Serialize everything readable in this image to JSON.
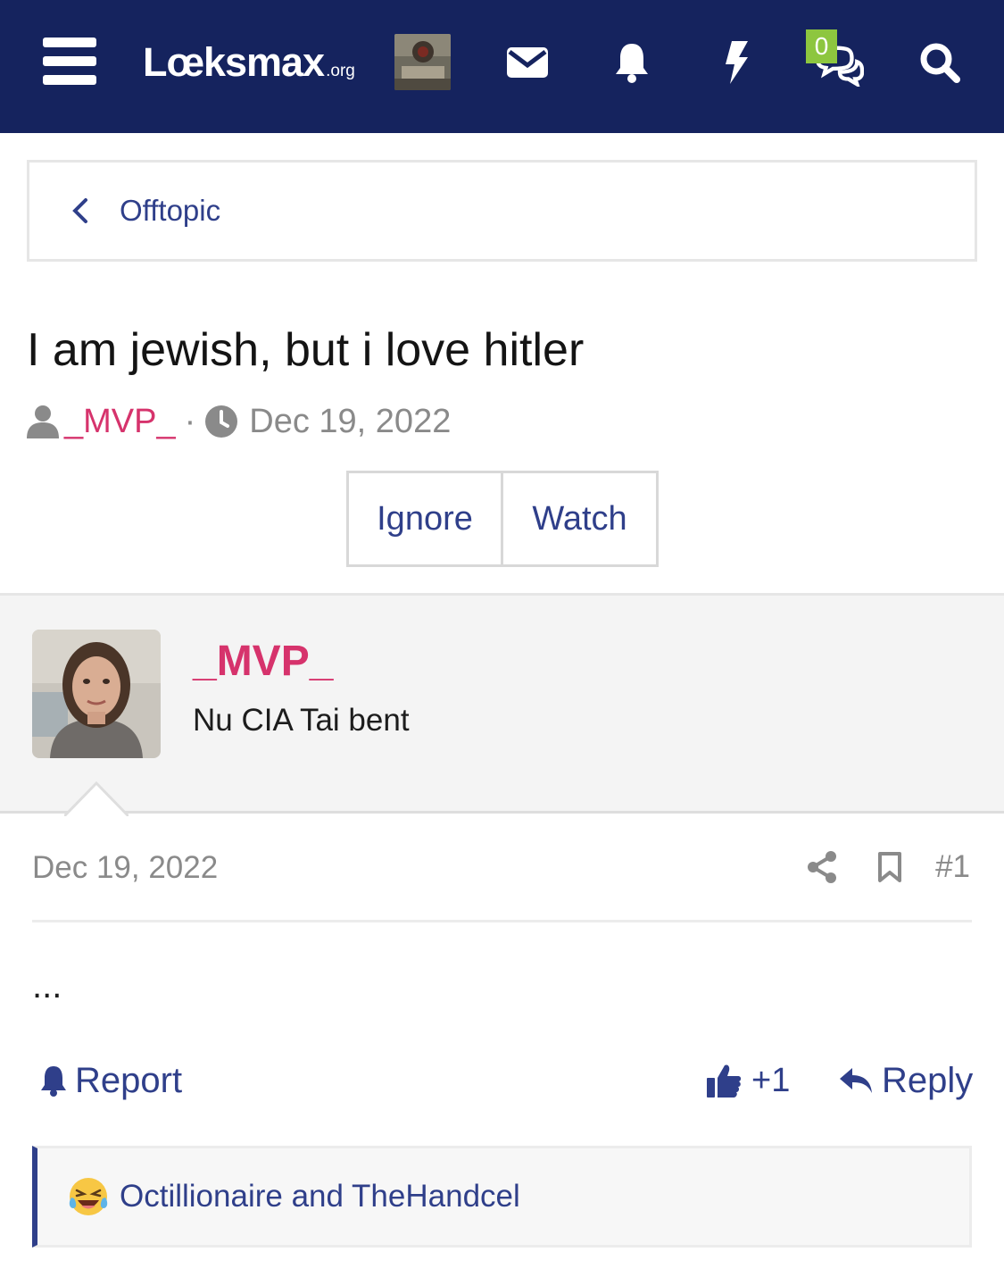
{
  "header": {
    "logo_text": "Lœksmax",
    "logo_suffix": ".org",
    "conversations_badge": "0",
    "icons": [
      "menu-icon",
      "envelope-icon",
      "bell-icon",
      "bolt-icon",
      "comments-icon",
      "search-icon"
    ],
    "bg_color": "#15235e",
    "badge_color": "#8dc63f"
  },
  "breadcrumb": {
    "label": "Offtopic"
  },
  "thread": {
    "title": "I am jewish, but i love hitler",
    "author": "_MVP_",
    "separator": "·",
    "date": "Dec 19, 2022",
    "ignore_label": "Ignore",
    "watch_label": "Watch"
  },
  "post": {
    "username": "_MVP_",
    "user_title": "Nu CIA Tai bent",
    "date": "Dec 19, 2022",
    "number": "#1",
    "body": "...",
    "report_label": "Report",
    "like_label": "+1",
    "reply_label": "Reply",
    "reactions_text": "Octillionaire and TheHandcel",
    "reaction_icon": "laughing-tears-emoji",
    "username_color": "#d6336c",
    "link_color": "#2f3f8a"
  }
}
